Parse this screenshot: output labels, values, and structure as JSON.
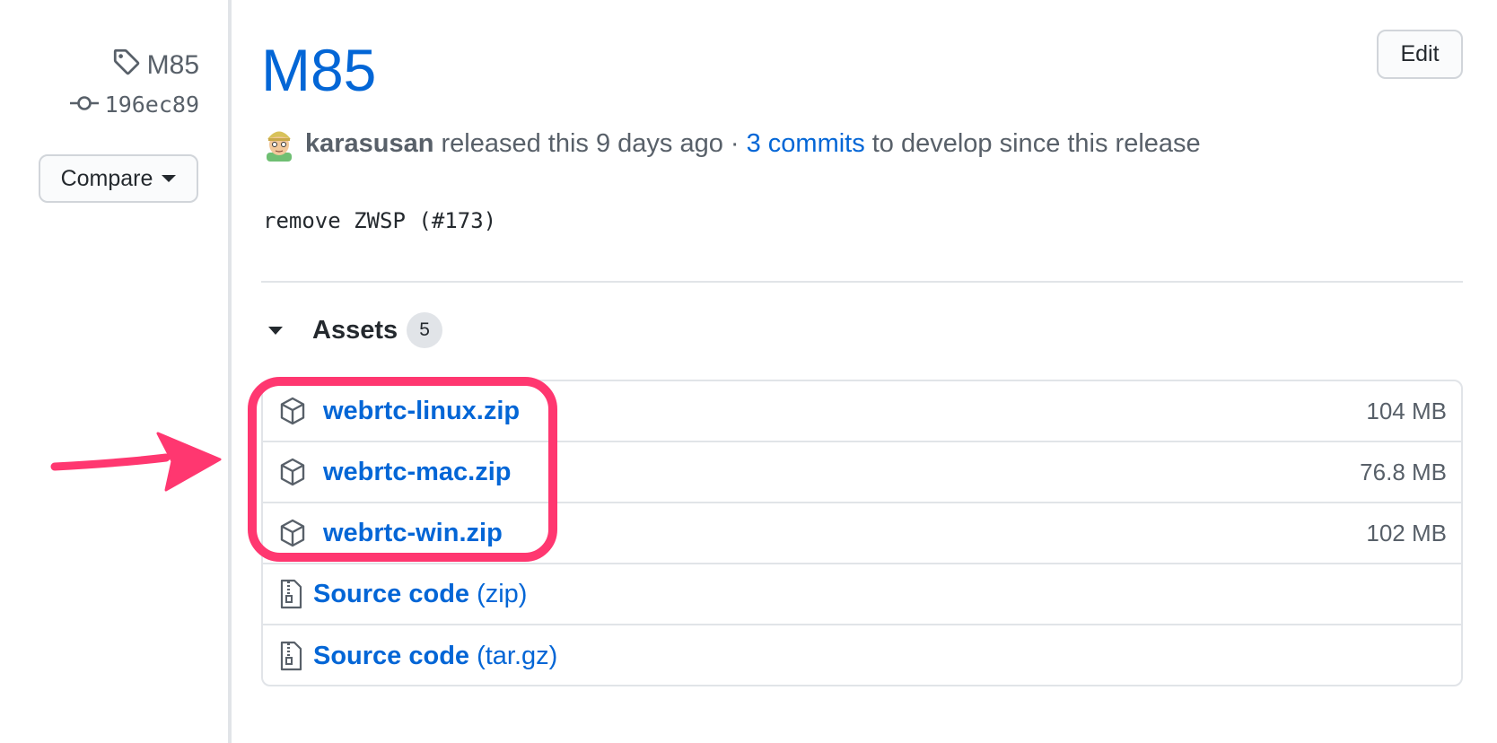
{
  "sidebar": {
    "tag": "M85",
    "commit": "196ec89",
    "compare_label": "Compare"
  },
  "release": {
    "title": "M85",
    "edit_label": "Edit",
    "author": "karasusan",
    "released_text": "released this 9 days ago ·",
    "commits_link": "3 commits",
    "commits_suffix": "to develop since this release",
    "body": "remove ZWSP (#173)"
  },
  "assets": {
    "heading": "Assets",
    "count": "5",
    "items": [
      {
        "name": "webrtc-linux.zip",
        "size": "104 MB",
        "icon": "package-icon"
      },
      {
        "name": "webrtc-mac.zip",
        "size": "76.8 MB",
        "icon": "package-icon"
      },
      {
        "name": "webrtc-win.zip",
        "size": "102 MB",
        "icon": "package-icon"
      }
    ],
    "sources": [
      {
        "name": "Source code",
        "format": "(zip)",
        "icon": "file-zip-icon"
      },
      {
        "name": "Source code",
        "format": "(tar.gz)",
        "icon": "file-zip-icon"
      }
    ]
  },
  "annotation": {
    "highlight_color": "#ff3770",
    "arrow_color": "#ff3770"
  },
  "colors": {
    "link": "#0366d6",
    "muted": "#586069",
    "border": "#e1e4e8"
  }
}
